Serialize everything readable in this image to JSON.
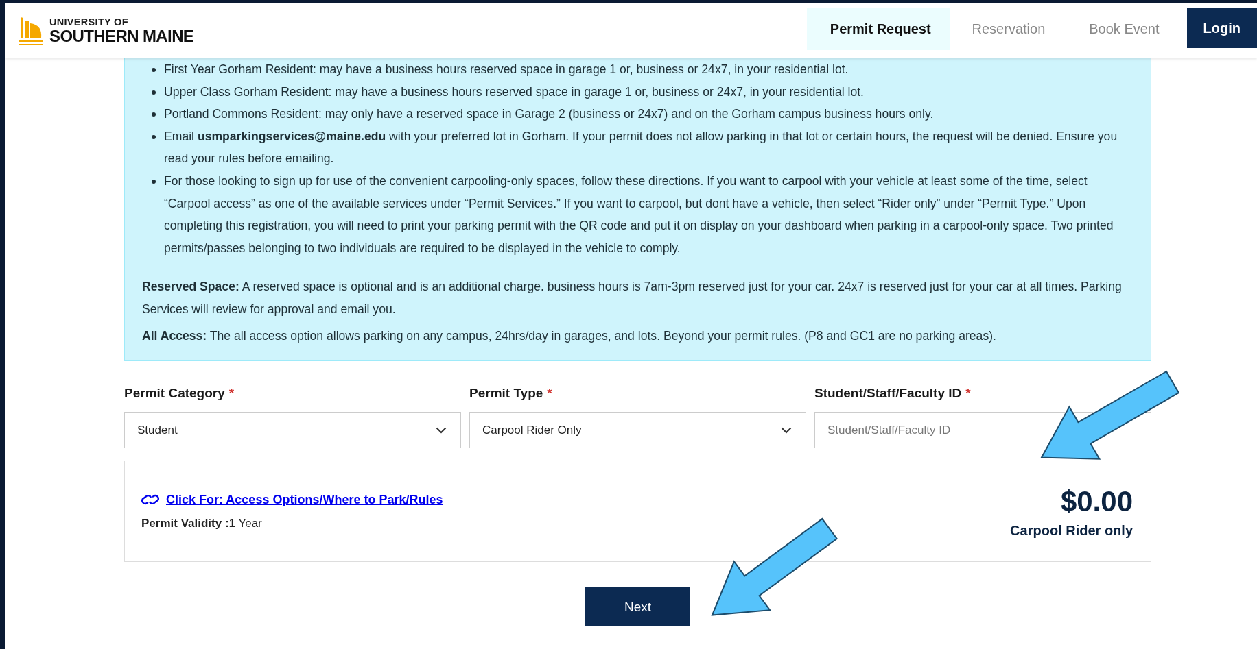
{
  "header": {
    "logo": {
      "line_1": "UNIVERSITY OF",
      "line_2": "SOUTHERN MAINE"
    },
    "nav": [
      {
        "label": "Permit Request",
        "selected": true
      },
      {
        "label": "Reservation",
        "selected": false
      },
      {
        "label": "Book Event",
        "selected": false
      }
    ],
    "login": "Login"
  },
  "info": {
    "bullets": [
      "First Year Gorham Resident: may have a business hours reserved space in garage 1 or, business or 24x7, in your residential lot.",
      "Upper Class Gorham Resident: may have a business hours reserved space in garage 1 or, business or 24x7, in your residential lot.",
      "Portland Commons Resident: may only have a reserved space in Garage 2 (business or 24x7) and on the Gorham campus business hours only.",
      "Email **usmparkingservices@maine.edu** with your preferred lot in Gorham. If your permit does not allow parking in that lot or certain hours, the request will be denied. Ensure you read your rules before emailing.",
      "For those looking to sign up for use of the convenient carpooling-only spaces, follow these directions. If you want to carpool with your vehicle at least some of the time, select “Carpool access” as one of the available services under “Permit Services.” If you want to carpool, but dont have a vehicle, then select “Rider only” under “Permit Type.” Upon completing this registration, you will need to print your parking permit with the QR code and put it on display on your dashboard when parking in a carpool-only space. Two printed permits/passes belonging to two individuals are required to be displayed in the vehicle to comply."
    ],
    "notes": [
      "**Reserved Space:** A reserved space is optional and is an additional charge. business hours is 7am-3pm reserved just for your car. 24x7 is reserved just for your car at all times. Parking Services will review for approval and email you.",
      "**All Access:** The all access option allows parking on any campus, 24hrs/day in garages, and lots. Beyond your permit rules. (P8 and GC1 are no parking areas)."
    ]
  },
  "fields": [
    {
      "kind": "select",
      "label": "Permit Category",
      "required_mark": "*",
      "value": "Student"
    },
    {
      "kind": "select",
      "label": "Permit Type",
      "required_mark": "*",
      "value": "Carpool Rider Only"
    },
    {
      "kind": "input",
      "label": "Student/Staff/Faculty ID",
      "required_mark": "*",
      "placeholder": "Student/Staff/Faculty ID"
    }
  ],
  "summary": {
    "link": "Click For: Access Options/Where to Park/Rules",
    "validity": "**Permit Validity :**1 Year",
    "price": "$0.00",
    "price_caption": "Carpool Rider only"
  },
  "next_button": "Next"
}
